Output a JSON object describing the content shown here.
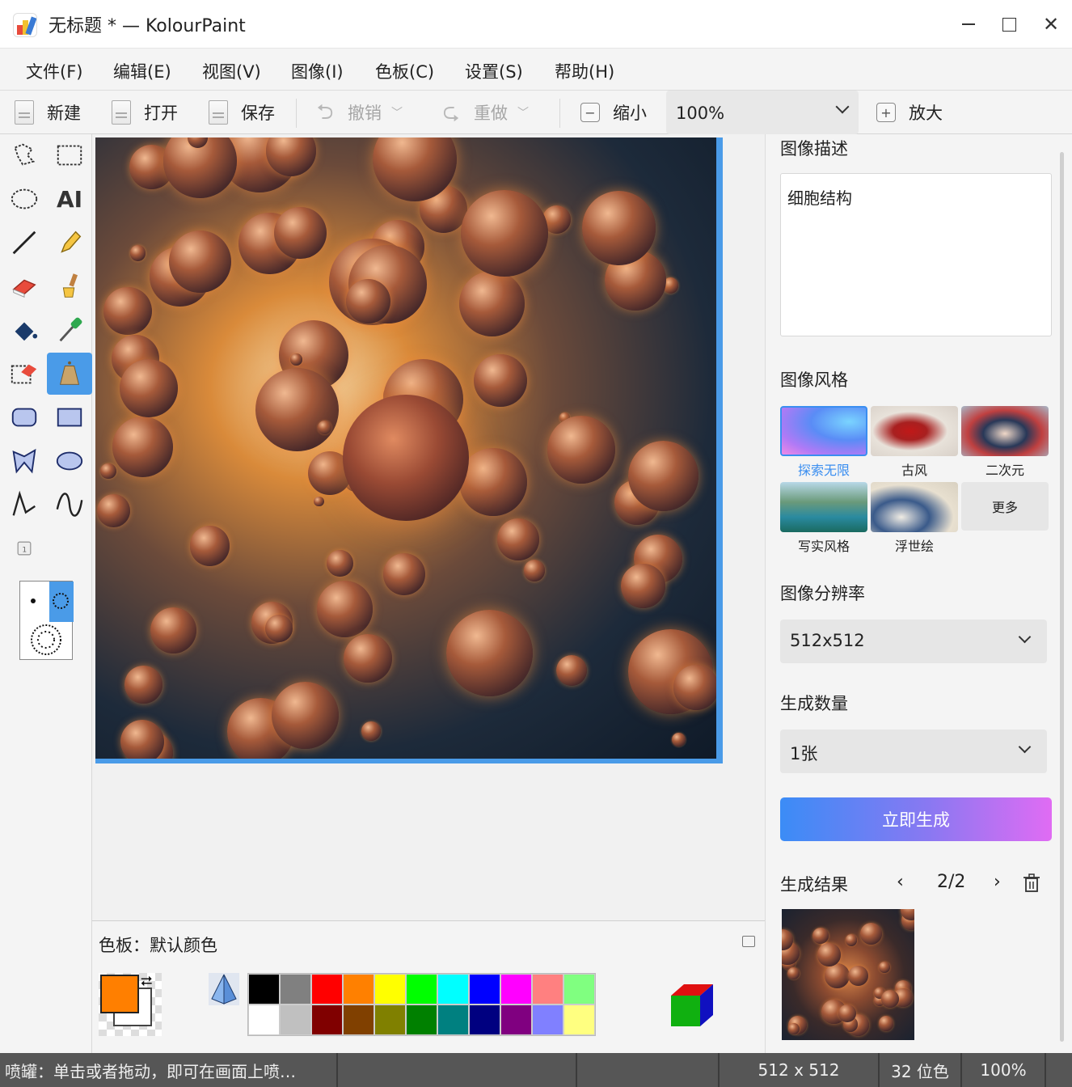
{
  "window": {
    "title": "无标题 * — KolourPaint",
    "minimize": "—",
    "close": "✕"
  },
  "menu": [
    "文件(F)",
    "编辑(E)",
    "视图(V)",
    "图像(I)",
    "色板(C)",
    "设置(S)",
    "帮助(H)"
  ],
  "toolbar": {
    "new_label": "新建",
    "open_label": "打开",
    "save_label": "保存",
    "undo_label": "撤销",
    "redo_label": "重做",
    "zoom_out_label": "缩小",
    "zoom_value": "100%",
    "zoom_in_label": "放大"
  },
  "tools": [
    "free-select-icon",
    "rect-select-icon",
    "ellipse-select-icon",
    "text-icon",
    "line-icon",
    "pen-icon",
    "eraser-icon",
    "brush-icon",
    "flood-fill-icon",
    "color-picker-icon",
    "color-eraser-icon",
    "spraycan-icon",
    "rounded-rect-icon",
    "rect-icon",
    "polygon-icon",
    "ellipse-icon",
    "polyline-icon",
    "curve-icon",
    "small-tool-icon"
  ],
  "tool_text_label": "AI",
  "palette": {
    "title": "色板：默认颜色",
    "foreground": "#ff7f00",
    "background": "#ffffff",
    "colors": [
      "#000000",
      "#808080",
      "#ff0000",
      "#ff8000",
      "#ffff00",
      "#00ff00",
      "#00ffff",
      "#0000ff",
      "#ff00ff",
      "#ff8080",
      "#80ff80",
      "#ffffff",
      "#c0c0c0",
      "#800000",
      "#804000",
      "#808000",
      "#008000",
      "#008080",
      "#000080",
      "#800080",
      "#8080ff",
      "#ffff80"
    ]
  },
  "right_panel": {
    "desc_label": "图像描述",
    "desc_value": "细胞结构",
    "style_label": "图像风格",
    "styles": [
      {
        "label": "探索无限",
        "selected": true
      },
      {
        "label": "古风",
        "selected": false
      },
      {
        "label": "二次元",
        "selected": false
      },
      {
        "label": "写实风格",
        "selected": false
      },
      {
        "label": "浮世绘",
        "selected": false
      }
    ],
    "more_label": "更多",
    "resolution_label": "图像分辨率",
    "resolution_value": "512x512",
    "count_label": "生成数量",
    "count_value": "1张",
    "generate_label": "立即生成",
    "result_label": "生成结果",
    "result_page": "2/2",
    "prev": "‹",
    "next": "›"
  },
  "status": {
    "hint": "喷罐：单击或者拖动，即可在画面上喷…",
    "size": "512 x 512",
    "depth": "32 位色",
    "zoom": "100%"
  }
}
